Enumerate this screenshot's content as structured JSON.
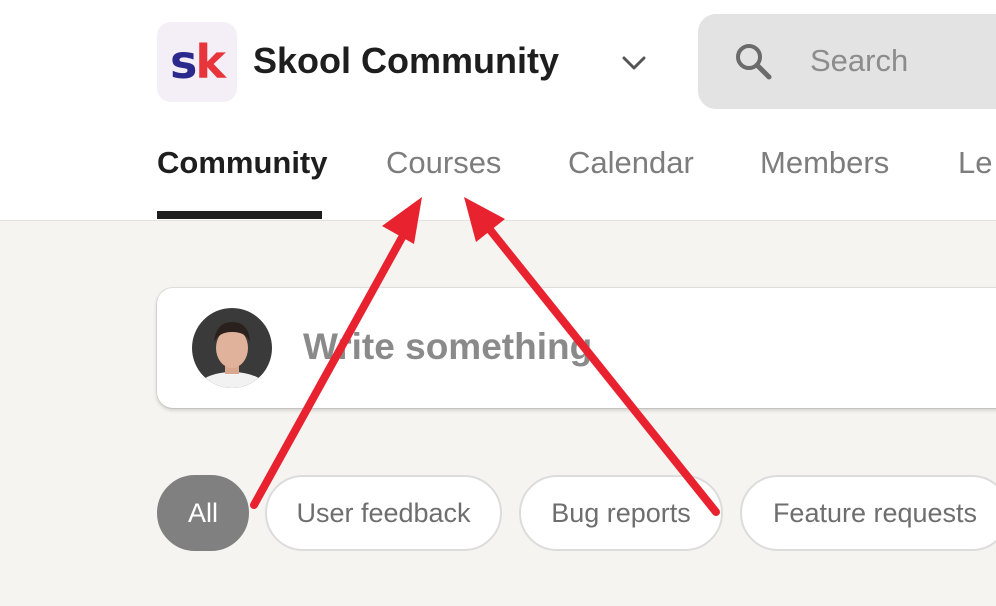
{
  "header": {
    "logo_text_s": "s",
    "logo_text_k": "k",
    "group_name": "Skool Community",
    "search": {
      "placeholder": "Search"
    }
  },
  "nav": {
    "tabs": [
      {
        "label": "Community",
        "active": true
      },
      {
        "label": "Courses",
        "active": false
      },
      {
        "label": "Calendar",
        "active": false
      },
      {
        "label": "Members",
        "active": false
      },
      {
        "label": "Le",
        "active": false
      }
    ]
  },
  "composer": {
    "placeholder": "Write something"
  },
  "filters": {
    "chips": [
      {
        "label": "All",
        "active": true
      },
      {
        "label": "User feedback",
        "active": false
      },
      {
        "label": "Bug reports",
        "active": false
      },
      {
        "label": "Feature requests",
        "active": false
      }
    ]
  },
  "colors": {
    "background": "#f5f4f1",
    "annotation_arrow": "#e8222f",
    "logo_s": "#2b2a8c",
    "logo_k": "#e8343b",
    "active_chip": "#808080"
  },
  "icons": [
    "chevron-down-icon",
    "search-icon",
    "arrow-annotation"
  ]
}
